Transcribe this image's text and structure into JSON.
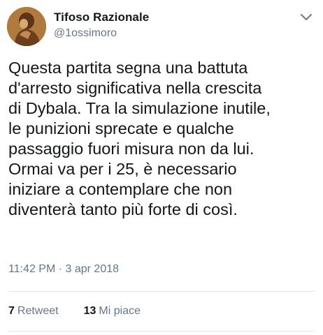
{
  "user": {
    "display_name": "Tifoso Razionale",
    "handle": "@1ossimoro"
  },
  "tweet": {
    "lines": [
      "Questa partita segna una battuta",
      "d'arresto significativa nella crescita",
      "di Dybala. Tra la simulazione inutile,",
      "le punizioni sprecate e qualche",
      "passaggio fuori misura non da lui.",
      "Ormai va per i 25, è necessario",
      "iniziare a contemplare che non",
      "diventerà tanto più forte di così."
    ],
    "timestamp": "11:42 PM · 3 apr 2018"
  },
  "stats": {
    "retweets_count": "7",
    "retweets_label": "Retweet",
    "likes_count": "13",
    "likes_label": "Mi piace"
  },
  "icons": {
    "menu": "chevron-down-icon",
    "avatar": "avatar-image"
  },
  "colors": {
    "text_primary": "#14171a",
    "text_secondary": "#657786",
    "divider": "#e1e8ed"
  }
}
